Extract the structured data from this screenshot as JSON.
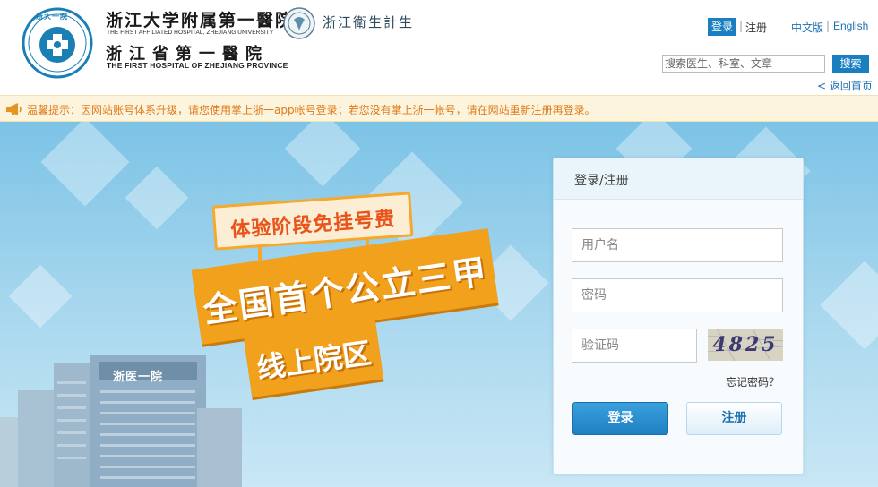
{
  "header": {
    "hospital_name_cn": "浙江大学附属第一醫院",
    "hospital_name_en": "THE FIRST AFFILIATED HOSPITAL, ZHEJIANG UNIVERSITY",
    "province_hospital_cn": "浙江省第一醫院",
    "province_hospital_en": "THE FIRST HOSPITAL OF ZHEJIANG PROVINCE",
    "emblem_text": "浙大一院",
    "health_commission": "浙江衛生計生"
  },
  "top_nav": {
    "login_label": "登录",
    "separator": "|",
    "register_label": "注册",
    "lang_cn": "中文版",
    "lang_en": "English"
  },
  "search": {
    "placeholder": "搜索医生、科室、文章",
    "button_label": "搜索",
    "back_home": "< 返回首页"
  },
  "notice": {
    "text": "温馨提示：因网站账号体系升级，请您使用掌上浙一app帐号登录；若您没有掌上浙一帐号，请在网站重新注册再登录。"
  },
  "banner": {
    "promo_sign": "体验阶段免挂号费",
    "headline": "全国首个公立三甲",
    "subheadline": "线上院区",
    "building_sign": "浙医一院"
  },
  "login_panel": {
    "title": "登录/注册",
    "username_placeholder": "用户名",
    "password_placeholder": "密码",
    "captcha_placeholder": "验证码",
    "captcha_value": "4825",
    "forgot_password": "忘记密码？",
    "login_button": "登录",
    "register_button": "注册"
  },
  "colors": {
    "brand_blue": "#1a7fc1",
    "notice_orange": "#e07a1a",
    "banner_orange": "#f2a11d"
  }
}
